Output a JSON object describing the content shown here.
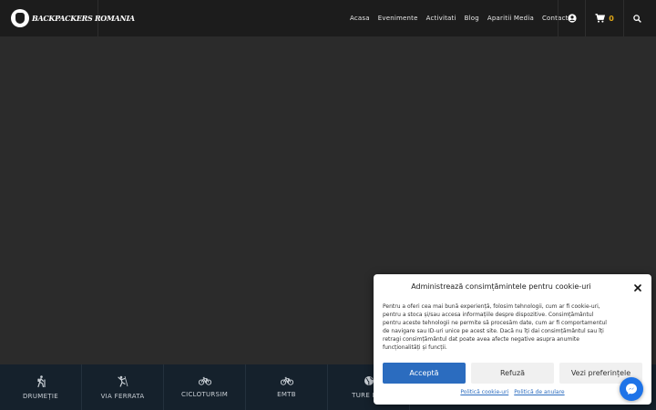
{
  "header": {
    "logo_text": "BACKPACKERS ROMANIA",
    "nav": [
      "Acasa",
      "Evenimente",
      "Activitati",
      "Blog",
      "Aparitii Media",
      "Contact"
    ],
    "cart_count": "0"
  },
  "categories": [
    {
      "label": "DRUMEȚIE",
      "icon": "hiker-icon"
    },
    {
      "label": "VIA FERRATA",
      "icon": "climber-icon"
    },
    {
      "label": "CICLOTURSIM",
      "icon": "bicycle-icon"
    },
    {
      "label": "EMTB",
      "icon": "bicycle-icon"
    },
    {
      "label": "TURE EXT",
      "icon": "globe-icon"
    }
  ],
  "cookie": {
    "title": "Administrează consimțămintele pentru cookie-uri",
    "body": "Pentru a oferi cea mai bună experiență, folosim tehnologii, cum ar fi cookie-uri, pentru a stoca și/sau accesa informațiile despre dispozitive. Consimțământul pentru aceste tehnologii ne permite să procesăm date, cum ar fi comportamentul de navigare sau ID-uri unice pe acest site. Dacă nu îți dai consimțământul sau îți retragi consimțământul dat poate avea afecte negative asupra anumite funcționalități și funcții.",
    "accept": "Acceptă",
    "refuse": "Refuză",
    "preferences": "Vezi preferințele",
    "link_cookie_policy": "Politică cookie-uri",
    "link_cancel_policy": "Politică de anulare"
  },
  "colors": {
    "header_bg": "#1c1c1c",
    "hero_bg": "#2b2b2b",
    "catbar_bg": "#15212c",
    "accent_gold": "#e1a716",
    "primary_blue": "#2b6cbf",
    "messenger_blue": "#1e73e8"
  }
}
